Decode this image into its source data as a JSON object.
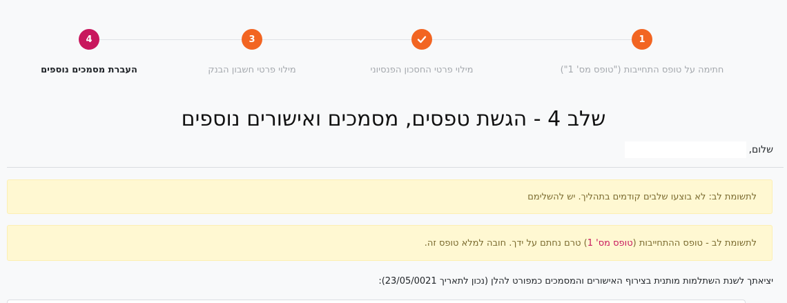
{
  "stepper": {
    "steps": [
      {
        "number": "1",
        "label": "חתימה על טופס התחייבות (\"טופס מס' 1\")",
        "state": "pending",
        "color": "#f26522"
      },
      {
        "number": "",
        "label": "מילוי פרטי החסכון הפנסיוני",
        "state": "completed",
        "icon": "check-icon",
        "color": "#f26522"
      },
      {
        "number": "3",
        "label": "מילוי פרטי חשבון הבנק",
        "state": "pending",
        "color": "#f26522"
      },
      {
        "number": "4",
        "label": "העברת מסמכים נוספים",
        "state": "active",
        "color": "#c8175d"
      }
    ]
  },
  "page": {
    "title": "שלב 4 - הגשת טפסים, מסמכים ואישורים נוספים",
    "greeting": "שלום,"
  },
  "alerts": [
    {
      "text": "לתשומת לב: לא בוצעו שלבים קודמים בתהליך. יש להשלימם"
    },
    {
      "prefix": "לתשומת לב - טופס ההתחייבות (",
      "link": "טופס מס' 1",
      "suffix": ") טרם נחתם על ידך. חובה למלא טופס זה."
    }
  ],
  "footer_text": "יציאתך לשנת השתלמות מותנית בצירוף האישורים והמסמכים כמפורט להלן (נכון לתאריך 23/05/0021):"
}
